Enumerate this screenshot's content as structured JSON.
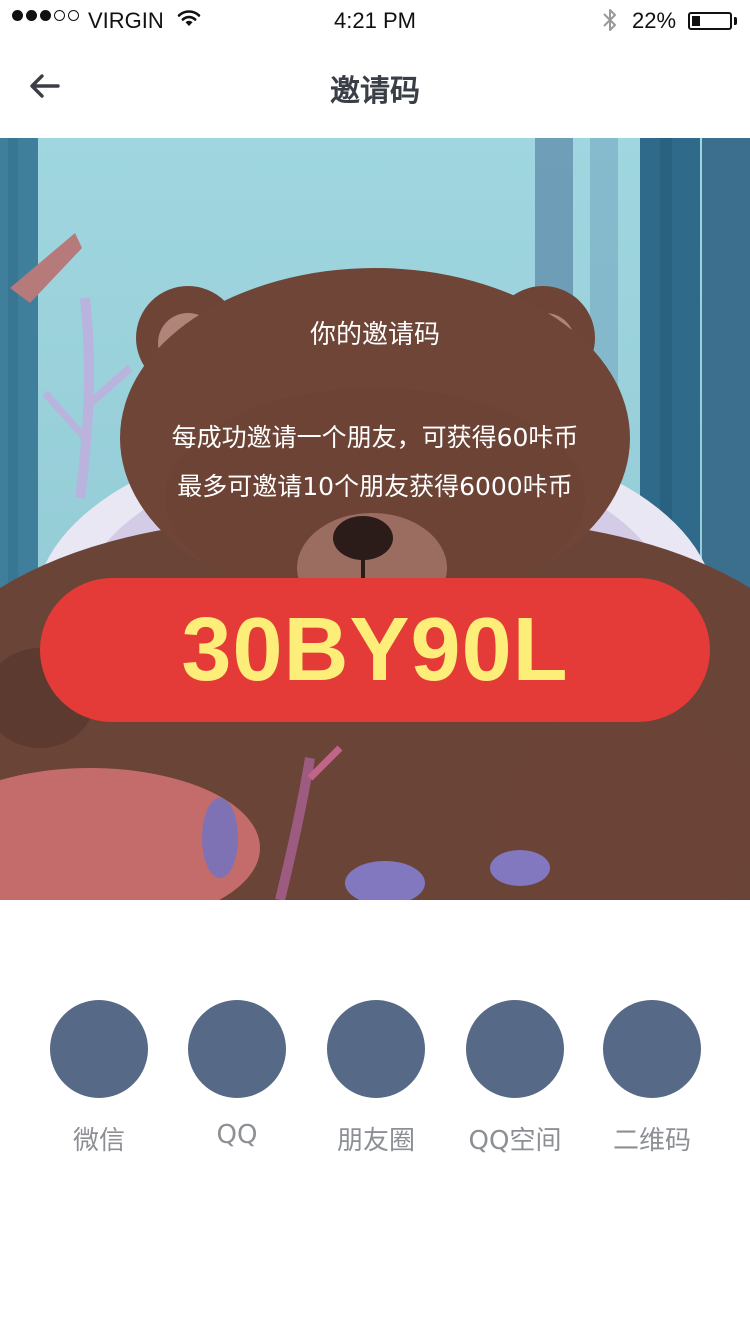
{
  "status_bar": {
    "carrier": "VIRGIN",
    "time": "4:21 PM",
    "battery_percent": "22%",
    "battery_level": 0.22,
    "signal_strength": 3,
    "signal_max": 5
  },
  "nav": {
    "title": "邀请码",
    "back_icon": "back-arrow-icon"
  },
  "invite": {
    "label": "你的邀请码",
    "line1": "每成功邀请一个朋友，可获得60咔币",
    "line2": "最多可邀请10个朋友获得6000咔币",
    "code": "30BY90L"
  },
  "share": [
    {
      "label": "微信"
    },
    {
      "label": "QQ"
    },
    {
      "label": "朋友圈"
    },
    {
      "label": "QQ空间"
    },
    {
      "label": "二维码"
    }
  ],
  "colors": {
    "code_pill": "#e53b38",
    "code_text": "#fcee79",
    "share_circle": "#566987",
    "share_label": "#8c8f94",
    "nav_title": "#3a3f47"
  }
}
